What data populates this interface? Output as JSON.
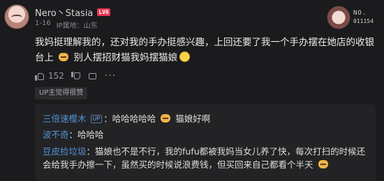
{
  "comment": {
    "username": "Nero丶Stasia",
    "level_badge": "LV6",
    "date": "1-16",
    "ip_location": "IP属地：山东",
    "text_part1": "我妈挺理解我的，还对我的手办挺感兴趣，上回还要了我一个手办摆在她店的收银台上",
    "text_part2": "别人摆招财猫我妈摆猫娘",
    "likes": "152",
    "liked_label": "UP主觉得很赞",
    "fan_badge": {
      "line1": "NO.",
      "line2": "011154"
    }
  },
  "replies": [
    {
      "user": "三倍速樱木",
      "up_tag": "UP",
      "text": "哈哈哈哈哈",
      "text_after": "猫娘好啊"
    },
    {
      "user": "波不奇",
      "text": "哈哈哈"
    },
    {
      "user": "豆皮捡垃圾",
      "text": "猫娘也不是不行，我的fufu都被我妈当女儿养了快，每次打扫的时候还会给我手办擦一下，虽然买的时候说浪费钱，但买回来自己都看个半天"
    }
  ],
  "colors": {
    "background": "#1b1b1d",
    "reply_user": "#4f93d4",
    "level_badge": "#e8334f"
  },
  "icons": [
    "avatar",
    "cat-emoji-icon",
    "sweat-emoji-icon",
    "thumb-up-icon",
    "thumb-down-icon",
    "share-icon",
    "more-icon"
  ]
}
